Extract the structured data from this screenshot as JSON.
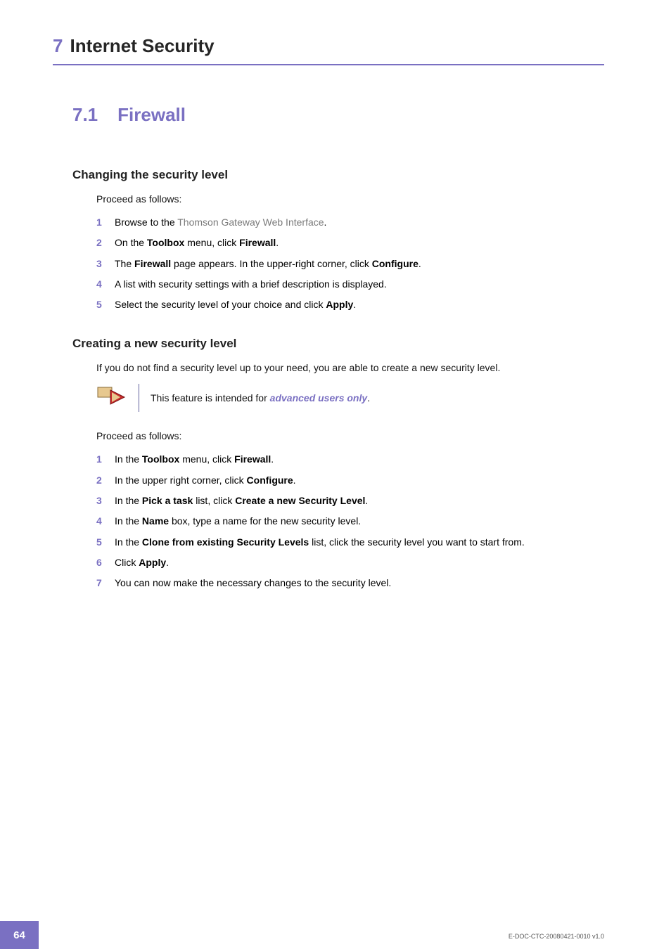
{
  "chapter": {
    "num": "7",
    "title": "Internet Security"
  },
  "section": {
    "num": "7.1",
    "title": "Firewall"
  },
  "sub1": {
    "heading": "Changing the security level",
    "intro": "Proceed as follows:",
    "steps": [
      {
        "n": "1",
        "pre": "Browse to the ",
        "link": "Thomson Gateway Web Interface",
        "post": "."
      },
      {
        "n": "2",
        "pre": "On the ",
        "b1": "Toolbox",
        "mid1": " menu, click ",
        "b2": "Firewall",
        "post": "."
      },
      {
        "n": "3",
        "pre": "The ",
        "b1": "Firewall",
        "mid1": " page appears. In the upper-right corner, click ",
        "b2": "Configure",
        "post": "."
      },
      {
        "n": "4",
        "text": "A list with security settings with a brief description is displayed."
      },
      {
        "n": "5",
        "pre": "Select the security level of your choice and click ",
        "b1": "Apply",
        "post": "."
      }
    ]
  },
  "sub2": {
    "heading": "Creating a new security level",
    "intro": "If you do not find a security level up to your need, you are able to create a new security level.",
    "note": {
      "pre": "This feature is intended for ",
      "em": "advanced users only",
      "post": "."
    },
    "intro2": "Proceed as follows:",
    "steps": [
      {
        "n": "1",
        "pre": "In the ",
        "b1": "Toolbox",
        "mid1": " menu, click ",
        "b2": "Firewall",
        "post": "."
      },
      {
        "n": "2",
        "pre": "In the upper right corner, click ",
        "b1": "Configure",
        "post": "."
      },
      {
        "n": "3",
        "pre": "In the ",
        "b1": "Pick a task",
        "mid1": " list, click ",
        "b2": "Create a new Security Level",
        "post": "."
      },
      {
        "n": "4",
        "pre": "In the ",
        "b1": "Name",
        "mid1": " box, type a name for the new security level."
      },
      {
        "n": "5",
        "pre": "In the ",
        "b1": "Clone from existing Security Levels",
        "mid1": " list, click the security level you want to start from."
      },
      {
        "n": "6",
        "pre": "Click ",
        "b1": "Apply",
        "post": "."
      },
      {
        "n": "7",
        "text": "You can now make the necessary changes to the security level."
      }
    ]
  },
  "footer": {
    "page": "64",
    "docid": "E-DOC-CTC-20080421-0010 v1.0"
  }
}
